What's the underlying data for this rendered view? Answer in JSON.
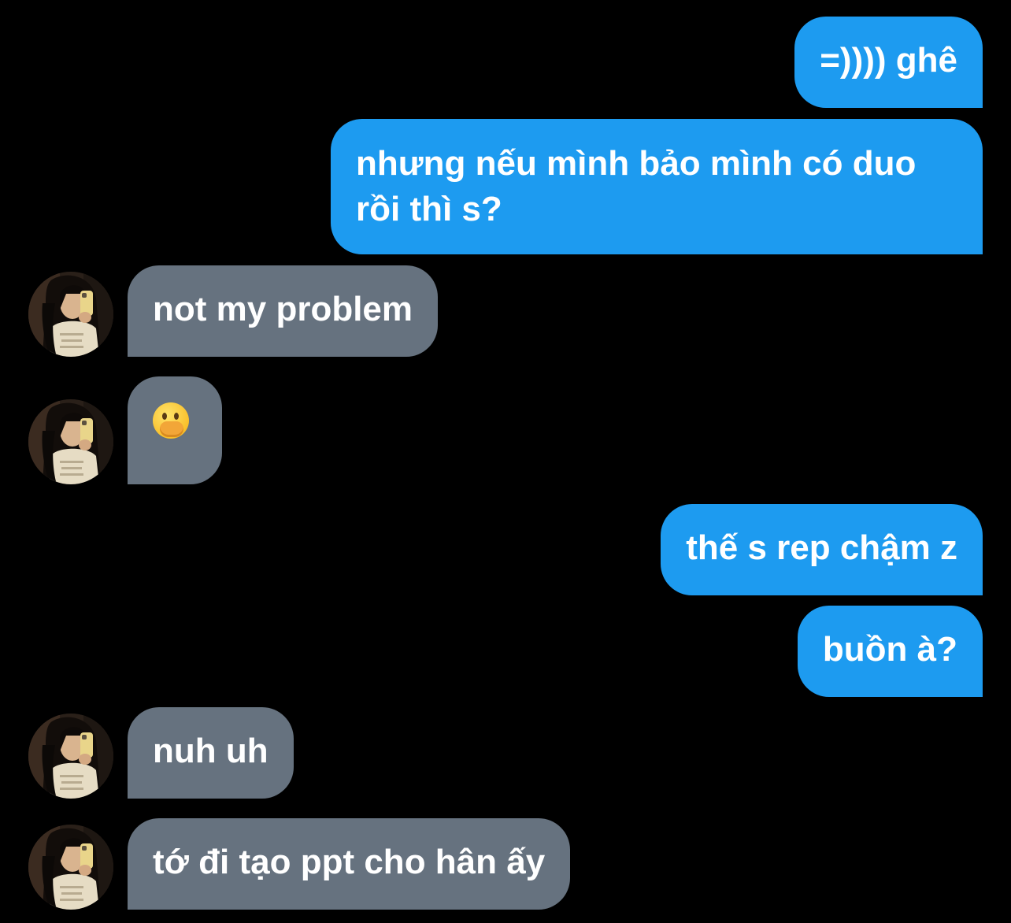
{
  "conversation": {
    "messages": [
      {
        "direction": "outgoing",
        "text": "=)))) ghê"
      },
      {
        "direction": "outgoing",
        "text": "nhưng nếu mình bảo mình có duo rồi thì s?"
      },
      {
        "direction": "incoming",
        "text": "not my problem",
        "has_avatar": true
      },
      {
        "direction": "incoming",
        "emoji": "face-with-hand-over-mouth",
        "has_avatar": true
      },
      {
        "direction": "outgoing",
        "text": "thế s rep chậm z"
      },
      {
        "direction": "outgoing",
        "text": "buồn à?"
      },
      {
        "direction": "incoming",
        "text": "nuh uh",
        "has_avatar": true
      },
      {
        "direction": "incoming",
        "text": "tớ đi tạo ppt cho hân ấy",
        "has_avatar": true
      }
    ]
  },
  "colors": {
    "background": "#000000",
    "outgoing_bubble": "#1d9bf0",
    "incoming_bubble": "#66727f",
    "text": "#ffffff"
  }
}
